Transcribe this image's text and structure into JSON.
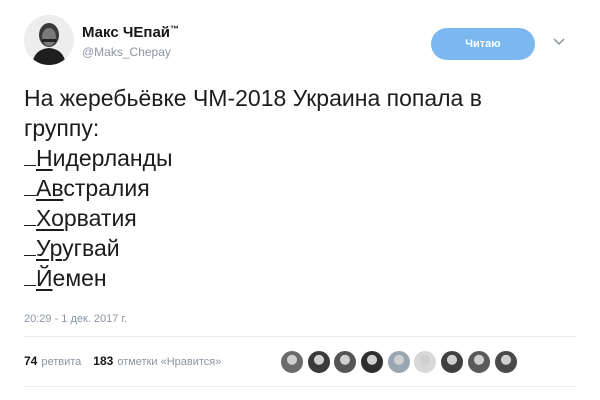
{
  "author": {
    "display_name": "Макс ЧЕпай",
    "trademark": "™",
    "handle": "@Maks_Chepay"
  },
  "follow_button": {
    "label": "Читаю"
  },
  "tweet": {
    "text_line1": "На жеребьёвке ЧМ-2018 Украина попала в",
    "text_line2": "группу:",
    "list": [
      {
        "first": "Н",
        "rest": "идерланды"
      },
      {
        "first": "Ав",
        "rest": "стралия"
      },
      {
        "first": "Хо",
        "rest": "рватия"
      },
      {
        "first": "Ур",
        "rest": "угвай"
      },
      {
        "first": "Й",
        "rest": "емен"
      }
    ],
    "timestamp": "20:29 - 1 дек. 2017 г."
  },
  "stats": {
    "retweets_count": "74",
    "retweets_label": "ретвита",
    "likes_count": "183",
    "likes_label": "отметки «Нравится»"
  },
  "colors": {
    "accent": "#7ab8ef",
    "muted": "#8a95a1",
    "text": "#14171a"
  },
  "likers": [
    {
      "name": "liker-avatar",
      "color": "#6b6b6b"
    },
    {
      "name": "liker-avatar",
      "color": "#3a3a3a"
    },
    {
      "name": "liker-avatar",
      "color": "#555555"
    },
    {
      "name": "liker-avatar",
      "color": "#2f2f2f"
    },
    {
      "name": "liker-avatar",
      "color": "#9aa6b2"
    },
    {
      "name": "liker-avatar",
      "color": "#d8d8d8"
    },
    {
      "name": "liker-avatar",
      "color": "#404040"
    },
    {
      "name": "liker-avatar",
      "color": "#5a5a5a"
    },
    {
      "name": "liker-avatar",
      "color": "#494949"
    }
  ]
}
